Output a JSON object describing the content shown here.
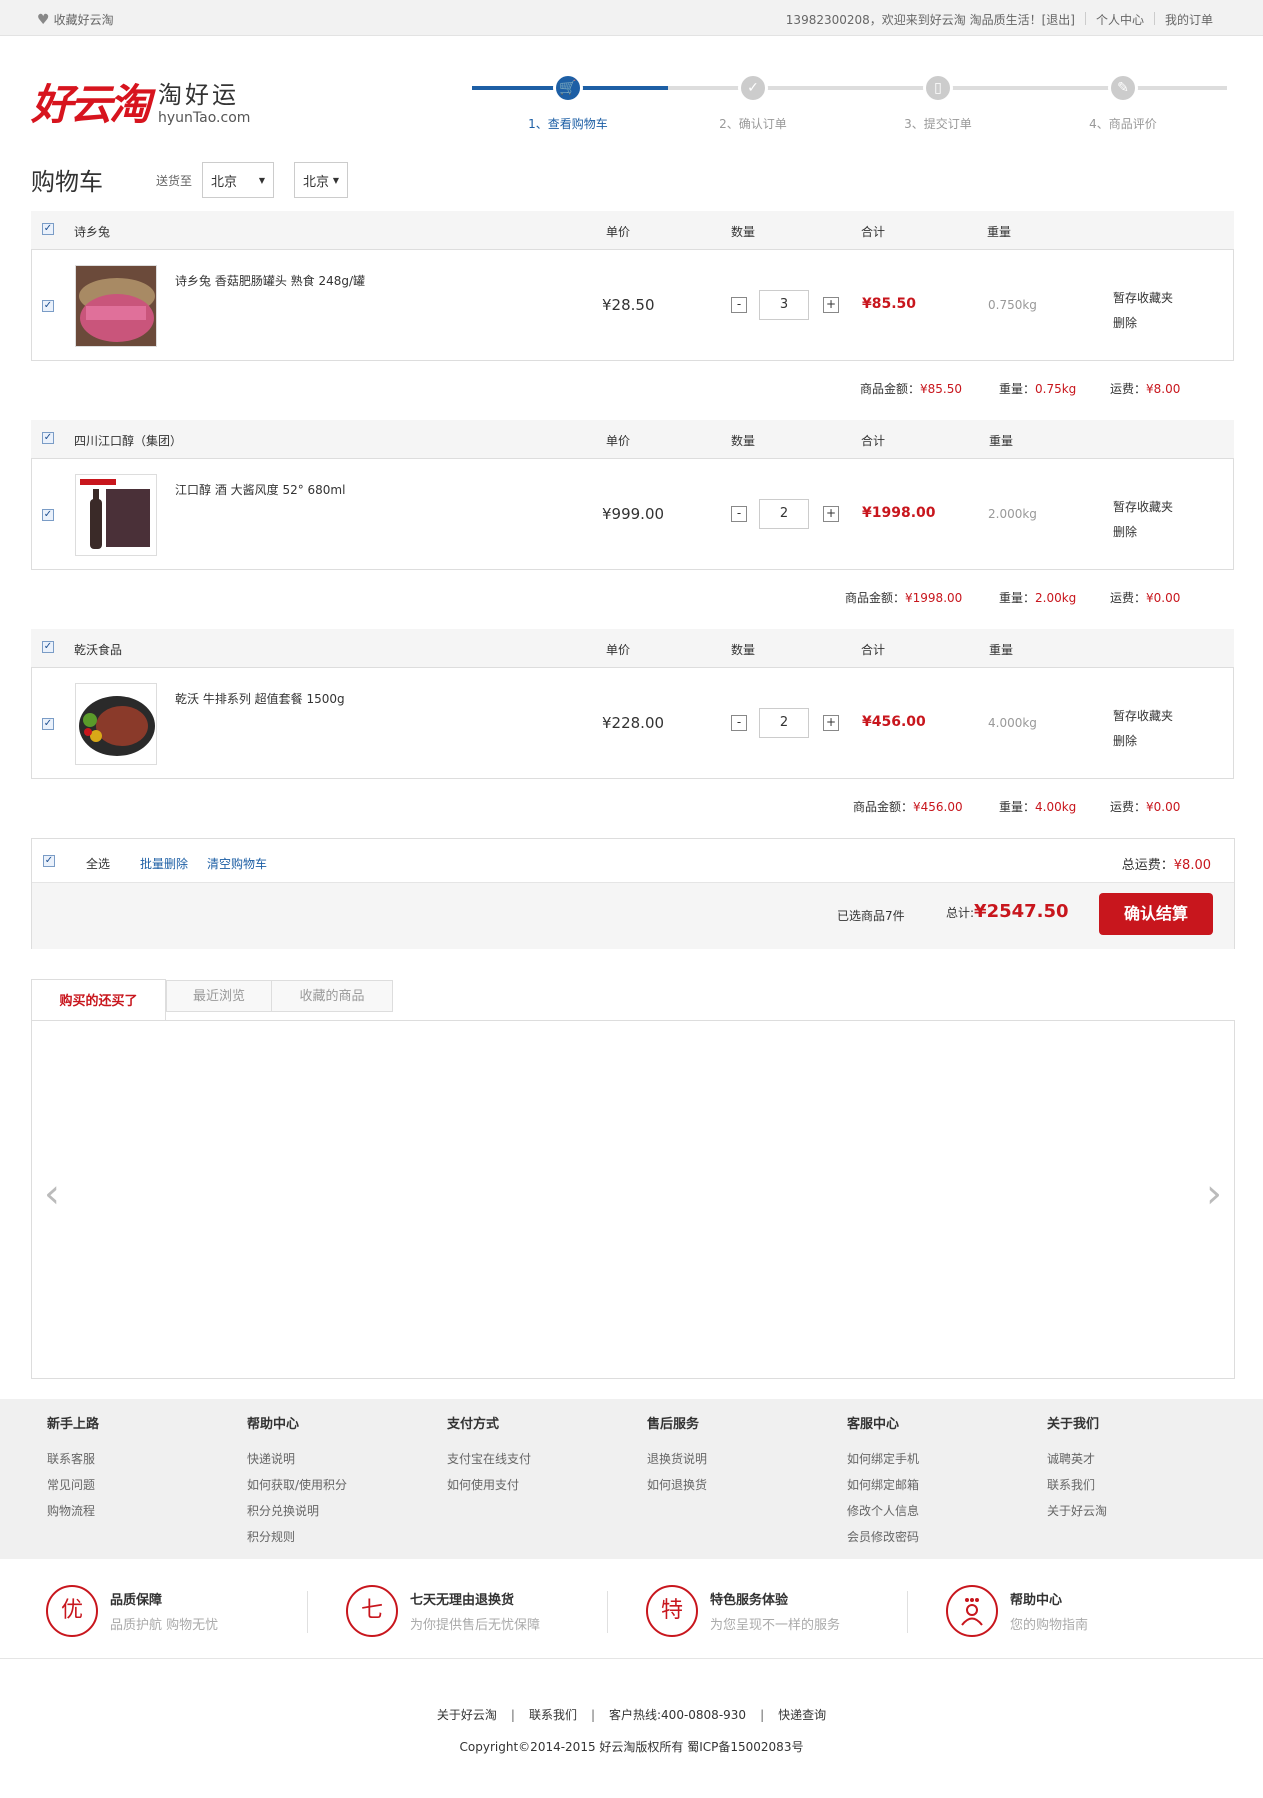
{
  "topbar": {
    "favorite": "收藏好云淘",
    "welcome": "13982300208，欢迎来到好云淘 淘品质生活！[退出]",
    "account": "个人中心",
    "orders": "我的订单"
  },
  "logo": {
    "brand": "好云淘",
    "slogan": "淘好运",
    "domain": "hyunTao.com"
  },
  "steps": [
    {
      "label": "1、查看购物车",
      "active": true
    },
    {
      "label": "2、确认订单",
      "active": false
    },
    {
      "label": "3、提交订单",
      "active": false
    },
    {
      "label": "4、商品评价",
      "active": false
    }
  ],
  "cart": {
    "title": "购物车",
    "ship_to_label": "送货至",
    "province": "北京",
    "city": "北京",
    "col_price": "单价",
    "col_qty": "数量",
    "col_total": "合计",
    "col_weight": "重量",
    "action_save": "暂存收藏夹",
    "action_delete": "删除",
    "shops": [
      {
        "name": "诗乡兔",
        "product": "诗乡兔 香菇肥肠罐头 熟食 248g/罐",
        "price": "¥28.50",
        "qty": "3",
        "subtotal": "¥85.50",
        "weight": "0.750kg",
        "sum_amount_label": "商品金额：",
        "sum_amount": "¥85.50",
        "sum_weight_label": "重量：",
        "sum_weight": "0.75kg",
        "sum_ship_label": "运费：",
        "sum_ship": "¥8.00"
      },
      {
        "name": "四川江口醇（集团）",
        "product": "江口醇 酒 大酱风度 52° 680ml",
        "price": "¥999.00",
        "qty": "2",
        "subtotal": "¥1998.00",
        "weight": "2.000kg",
        "sum_amount_label": "商品金额：",
        "sum_amount": "¥1998.00",
        "sum_weight_label": "重量：",
        "sum_weight": "2.00kg",
        "sum_ship_label": "运费：",
        "sum_ship": "¥0.00"
      },
      {
        "name": "乾沃食品",
        "product": "乾沃 牛排系列 超值套餐 1500g",
        "price": "¥228.00",
        "qty": "2",
        "subtotal": "¥456.00",
        "weight": "4.000kg",
        "sum_amount_label": "商品金额：",
        "sum_amount": "¥456.00",
        "sum_weight_label": "重量：",
        "sum_weight": "4.00kg",
        "sum_ship_label": "运费：",
        "sum_ship": "¥0.00"
      }
    ],
    "select_all": "全选",
    "batch_delete": "批量删除",
    "clear_cart": "清空购物车",
    "total_ship_label": "总运费：",
    "total_ship": "¥8.00",
    "selected_prefix": "已选商品",
    "selected_count": "7",
    "selected_unit": "件",
    "total_label": "总计:",
    "total": "¥2547.50",
    "checkout": "确认结算"
  },
  "tabs": [
    "购买的还买了",
    "最近浏览",
    "收藏的商品"
  ],
  "help": [
    {
      "title": "新手上路",
      "links": [
        "联系客服",
        "常见问题",
        "购物流程"
      ]
    },
    {
      "title": "帮助中心",
      "links": [
        "快递说明",
        "如何获取/使用积分",
        "积分兑换说明",
        "积分规则"
      ]
    },
    {
      "title": "支付方式",
      "links": [
        "支付宝在线支付",
        "如何使用支付"
      ]
    },
    {
      "title": "售后服务",
      "links": [
        "退换货说明",
        "如何退换货"
      ]
    },
    {
      "title": "客服中心",
      "links": [
        "如何绑定手机",
        "如何绑定邮箱",
        "修改个人信息",
        "会员修改密码"
      ]
    },
    {
      "title": "关于我们",
      "links": [
        "诚聘英才",
        "联系我们",
        "关于好云淘"
      ]
    }
  ],
  "promises": [
    {
      "icon": "优",
      "title": "品质保障",
      "sub": "品质护航 购物无忧"
    },
    {
      "icon": "七",
      "title": "七天无理由退换货",
      "sub": "为你提供售后无忧保障"
    },
    {
      "icon": "特",
      "title": "特色服务体验",
      "sub": "为您呈现不一样的服务"
    },
    {
      "icon": "help-person-icon",
      "title": "帮助中心",
      "sub": "您的购物指南"
    }
  ],
  "footer": {
    "links": [
      "关于好云淘",
      "联系我们",
      "客户热线:400-0808-930",
      "快递查询"
    ],
    "copyright": "Copyright©2014-2015 好云淘版权所有   蜀ICP备15002083号"
  },
  "colors": {
    "accent_red": "#c8161d",
    "accent_blue": "#1d5fa5"
  }
}
